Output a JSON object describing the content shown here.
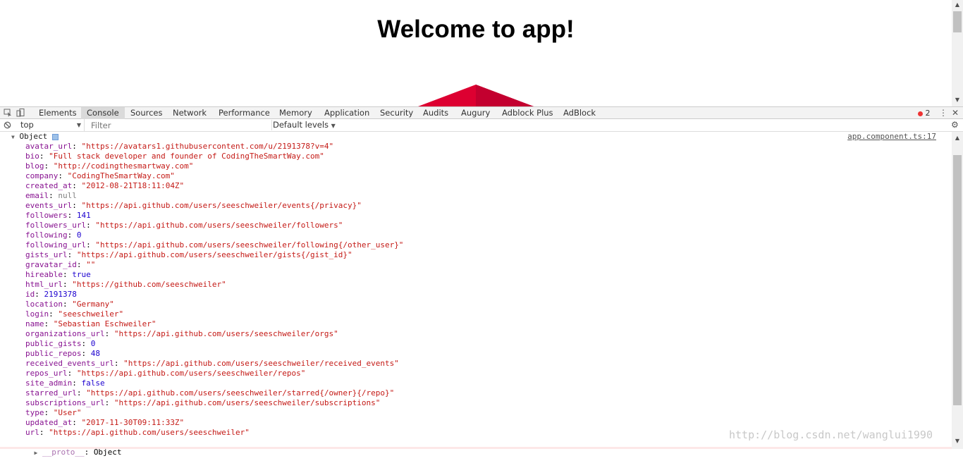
{
  "page": {
    "title": "Welcome to app!"
  },
  "devtools": {
    "tabs": [
      "Elements",
      "Console",
      "Sources",
      "Network",
      "Performance",
      "Memory",
      "Application",
      "Security",
      "Audits",
      "Augury",
      "Adblock Plus",
      "AdBlock"
    ],
    "active_tab": "Console",
    "error_count": "2",
    "context_value": "top",
    "filter_placeholder": "Filter",
    "levels_label": "Default levels"
  },
  "console": {
    "object_label": "Object",
    "source_link": "app.component.ts:17",
    "properties": [
      {
        "key": "avatar_url",
        "value": "\"https://avatars1.githubusercontent.com/u/2191378?v=4\"",
        "type": "string"
      },
      {
        "key": "bio",
        "value": "\"Full stack developer and founder of CodingTheSmartWay.com\"",
        "type": "string"
      },
      {
        "key": "blog",
        "value": "\"http://codingthesmartway.com\"",
        "type": "string"
      },
      {
        "key": "company",
        "value": "\"CodingTheSmartWay.com\"",
        "type": "string"
      },
      {
        "key": "created_at",
        "value": "\"2012-08-21T18:11:04Z\"",
        "type": "string"
      },
      {
        "key": "email",
        "value": "null",
        "type": "null"
      },
      {
        "key": "events_url",
        "value": "\"https://api.github.com/users/seeschweiler/events{/privacy}\"",
        "type": "string"
      },
      {
        "key": "followers",
        "value": "141",
        "type": "number"
      },
      {
        "key": "followers_url",
        "value": "\"https://api.github.com/users/seeschweiler/followers\"",
        "type": "string"
      },
      {
        "key": "following",
        "value": "0",
        "type": "number"
      },
      {
        "key": "following_url",
        "value": "\"https://api.github.com/users/seeschweiler/following{/other_user}\"",
        "type": "string"
      },
      {
        "key": "gists_url",
        "value": "\"https://api.github.com/users/seeschweiler/gists{/gist_id}\"",
        "type": "string"
      },
      {
        "key": "gravatar_id",
        "value": "\"\"",
        "type": "string"
      },
      {
        "key": "hireable",
        "value": "true",
        "type": "number"
      },
      {
        "key": "html_url",
        "value": "\"https://github.com/seeschweiler\"",
        "type": "string"
      },
      {
        "key": "id",
        "value": "2191378",
        "type": "number"
      },
      {
        "key": "location",
        "value": "\"Germany\"",
        "type": "string"
      },
      {
        "key": "login",
        "value": "\"seeschweiler\"",
        "type": "string"
      },
      {
        "key": "name",
        "value": "\"Sebastian Eschweiler\"",
        "type": "string"
      },
      {
        "key": "organizations_url",
        "value": "\"https://api.github.com/users/seeschweiler/orgs\"",
        "type": "string"
      },
      {
        "key": "public_gists",
        "value": "0",
        "type": "number"
      },
      {
        "key": "public_repos",
        "value": "48",
        "type": "number"
      },
      {
        "key": "received_events_url",
        "value": "\"https://api.github.com/users/seeschweiler/received_events\"",
        "type": "string"
      },
      {
        "key": "repos_url",
        "value": "\"https://api.github.com/users/seeschweiler/repos\"",
        "type": "string"
      },
      {
        "key": "site_admin",
        "value": "false",
        "type": "number"
      },
      {
        "key": "starred_url",
        "value": "\"https://api.github.com/users/seeschweiler/starred{/owner}{/repo}\"",
        "type": "string"
      },
      {
        "key": "subscriptions_url",
        "value": "\"https://api.github.com/users/seeschweiler/subscriptions\"",
        "type": "string"
      },
      {
        "key": "type",
        "value": "\"User\"",
        "type": "string"
      },
      {
        "key": "updated_at",
        "value": "\"2017-11-30T09:11:33Z\"",
        "type": "string"
      },
      {
        "key": "url",
        "value": "\"https://api.github.com/users/seeschweiler\"",
        "type": "string"
      }
    ],
    "proto_key": "__proto__",
    "proto_value": "Object"
  },
  "watermark": "http://blog.csdn.net/wanglui1990",
  "colors": {
    "key": "#881391",
    "string": "#c41a16",
    "number": "#1c00cf",
    "logo_red": "#dd0031",
    "logo_dark": "#c3002f"
  }
}
